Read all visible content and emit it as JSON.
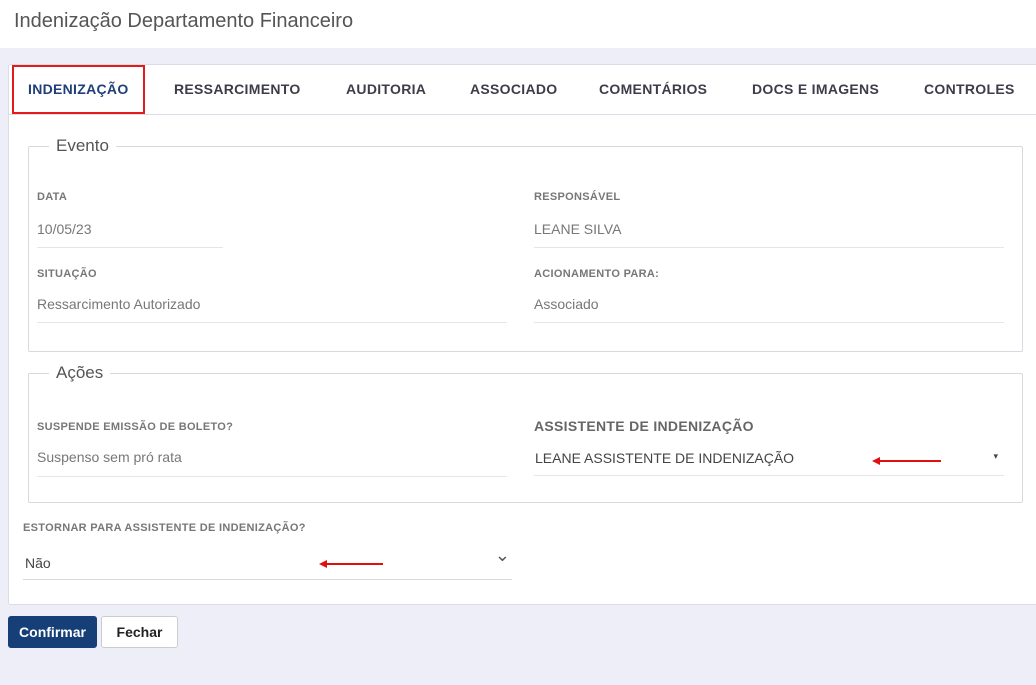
{
  "header": {
    "title": "Indenização Departamento Financeiro"
  },
  "tabs": [
    {
      "label": "INDENIZAÇÃO",
      "active": true
    },
    {
      "label": "RESSARCIMENTO",
      "active": false
    },
    {
      "label": "AUDITORIA",
      "active": false
    },
    {
      "label": "ASSOCIADO",
      "active": false
    },
    {
      "label": "COMENTÁRIOS",
      "active": false
    },
    {
      "label": "DOCS E IMAGENS",
      "active": false
    },
    {
      "label": "CONTROLES",
      "active": false
    }
  ],
  "evento": {
    "legend": "Evento",
    "data": {
      "label": "DATA",
      "value": "10/05/23"
    },
    "responsavel": {
      "label": "RESPONSÁVEL",
      "value": "LEANE SILVA"
    },
    "situacao": {
      "label": "SITUAÇÃO",
      "value": "Ressarcimento Autorizado"
    },
    "acionamento": {
      "label": "ACIONAMENTO PARA:",
      "value": "Associado"
    }
  },
  "acoes": {
    "legend": "Ações",
    "suspende": {
      "label": "SUSPENDE EMISSÃO DE BOLETO?",
      "value": "Suspenso sem pró rata"
    },
    "assistente": {
      "label": "ASSISTENTE DE INDENIZAÇÃO",
      "value": "LEANE ASSISTENTE DE INDENIZAÇÃO",
      "caret": "▾"
    }
  },
  "estornar": {
    "label": "ESTORNAR PARA ASSISTENTE DE INDENIZAÇÃO?",
    "value": "Não",
    "caret": "⌄"
  },
  "buttons": {
    "confirm": "Confirmar",
    "close": "Fechar"
  },
  "colors": {
    "accent": "#163f78",
    "highlight": "#e31b1b",
    "annotation_arrow": "#e01010"
  }
}
